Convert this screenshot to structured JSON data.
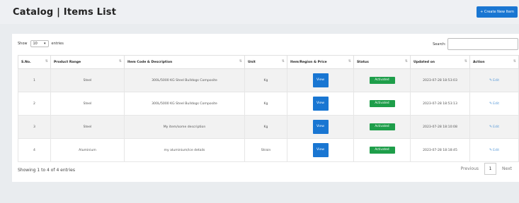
{
  "header": {
    "title": "Catalog | Items List",
    "create_button": "+ Create New Item"
  },
  "controls": {
    "show_label": "Show",
    "show_value": "10",
    "entries_label": "entries",
    "search_label": "Search:",
    "search_value": ""
  },
  "table": {
    "columns": [
      "S.No.",
      "Product Range",
      "Item Code & Description",
      "Unit",
      "Item/Region & Price",
      "Status",
      "Updated on",
      "Action"
    ],
    "rows": [
      {
        "sno": "1",
        "range": "Steel",
        "description": "300L/5000 KG Steel Bulldogs Composite",
        "unit": "Kg",
        "view": "View",
        "status": "Activated",
        "updated": "2023-07-28 18:53:03",
        "action": "Edit"
      },
      {
        "sno": "2",
        "range": "Steel",
        "description": "300L/5000 KG Steel Bulldogs Composite",
        "unit": "Kg",
        "view": "View",
        "status": "Activated",
        "updated": "2023-07-28 18:53:13",
        "action": "Edit"
      },
      {
        "sno": "3",
        "range": "Steel",
        "description": "My item/some description",
        "unit": "Kg",
        "view": "View",
        "status": "Activated",
        "updated": "2023-07-28 18:10:08",
        "action": "Edit"
      },
      {
        "sno": "4",
        "range": "Aluminium",
        "description": "my aluminium/ice details",
        "unit": "Strain",
        "view": "View",
        "status": "Activated",
        "updated": "2023-07-28 18:18:45",
        "action": "Edit"
      }
    ]
  },
  "footer": {
    "info": "Showing 1 to 4 of 4 entries",
    "previous": "Previous",
    "current_page": "1",
    "next": "Next"
  },
  "colors": {
    "primary": "#1976d2",
    "status_active": "#1e9e4a"
  }
}
